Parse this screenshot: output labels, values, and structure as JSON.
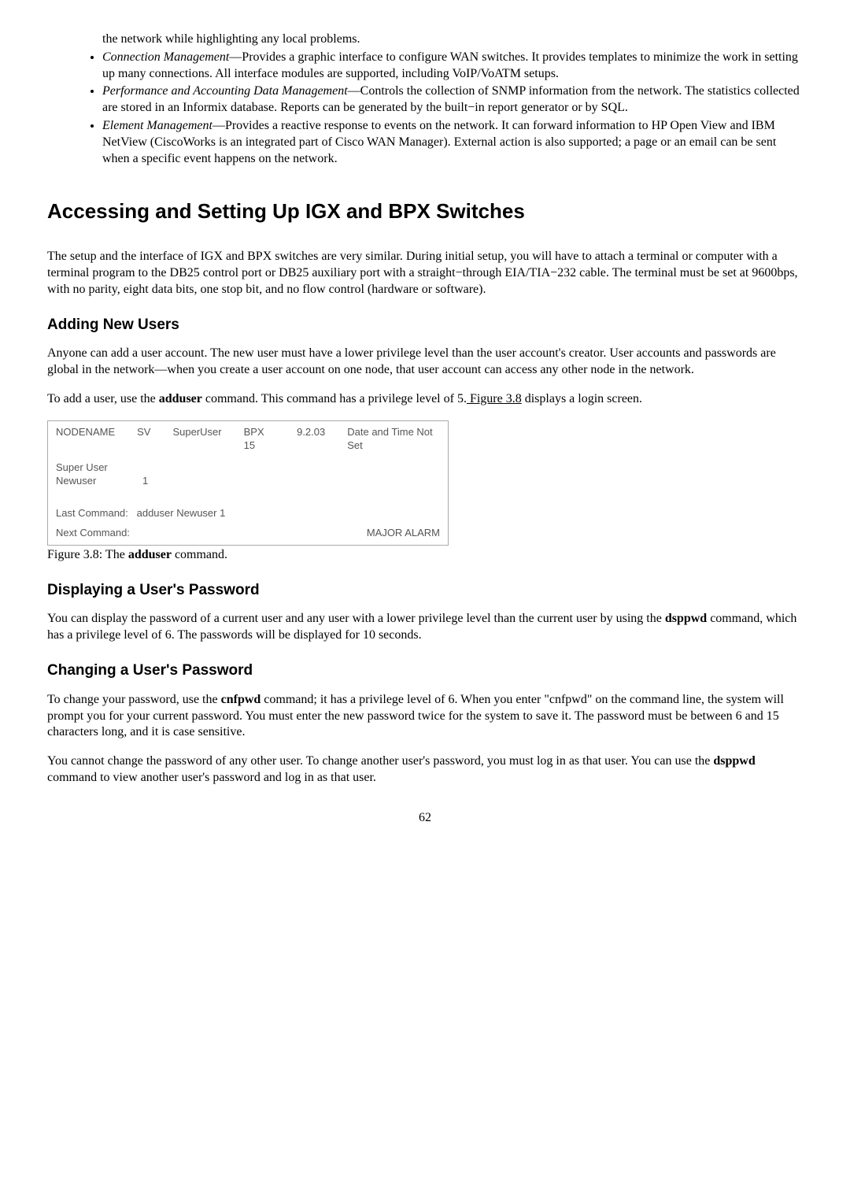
{
  "bullets": {
    "pre": "the network while highlighting any local problems.",
    "b1_em": "Connection Management",
    "b1_text": "—Provides a graphic interface to configure WAN switches. It provides templates to minimize the work in setting up many connections. All interface modules are supported, including VoIP/VoATM setups.",
    "b2_em": "Performance and Accounting Data Management",
    "b2_text": "—Controls the collection of SNMP information from the network. The statistics collected are stored in an Informix database. Reports can be generated by the built−in report generator or by SQL.",
    "b3_em": "Element Management",
    "b3_text": "—Provides a reactive response to events on the network. It can forward information to HP Open View and IBM NetView (CiscoWorks is an integrated part of Cisco WAN Manager). External action is also supported; a page or an email can be sent when a specific event happens on the network."
  },
  "h1": "Accessing and Setting Up IGX and BPX Switches",
  "p1": "The setup and the interface of IGX and BPX switches are very similar. During initial setup, you will have to attach a terminal or computer with a terminal program to the DB25 control port or DB25 auxiliary port with a straight−through EIA/TIA−232 cable. The terminal must be set at 9600bps, with no parity, eight data bits, one stop bit, and no flow control (hardware or software).",
  "h2a": "Adding New Users",
  "p2": "Anyone can add a user account. The new user must have a lower privilege level than the user account's creator. User accounts and passwords are global in the network—when you create a user account on one node, that user account can access any other node in the network.",
  "p3_a": "To add a user, use the ",
  "p3_b": "adduser",
  "p3_c": " command. This command has a privilege level of 5.",
  "p3_link": " Figure 3.8",
  "p3_d": " displays a login screen.",
  "figure": {
    "nodename": "NODENAME",
    "sv": "SV",
    "superuser": "SuperUser",
    "bpx": "BPX 15",
    "ver": "9.2.03",
    "date": "Date and Time Not Set",
    "su": "Super User",
    "nu": "Newuser",
    "one": "1",
    "last": "Last Command:",
    "lastv": "adduser Newuser 1",
    "next": "Next Command:",
    "alarm": "MAJOR ALARM"
  },
  "caption_a": "Figure 3.8: The ",
  "caption_b": "adduser",
  "caption_c": " command.",
  "h2b": "Displaying a User's Password",
  "p4_a": "You can display the password of a current user and any user with a lower privilege level than the current user by using the ",
  "p4_b": "dsppwd",
  "p4_c": " command, which has a privilege level of 6. The passwords will be displayed for 10 seconds.",
  "h2c": "Changing a User's Password",
  "p5_a": "To change your password, use the ",
  "p5_b": "cnfpwd",
  "p5_c": " command; it has a privilege level of 6. When you enter \"cnfpwd\" on the command line, the system will prompt you for your current password. You must enter the new password twice for the system to save it. The password must be between 6 and 15 characters long, and it is case sensitive.",
  "p6_a": "You cannot change the password of any other user. To change another user's password, you must log in as that user. You can use the ",
  "p6_b": "dsppwd",
  "p6_c": " command to view another user's password and log in as that user.",
  "page": "62"
}
